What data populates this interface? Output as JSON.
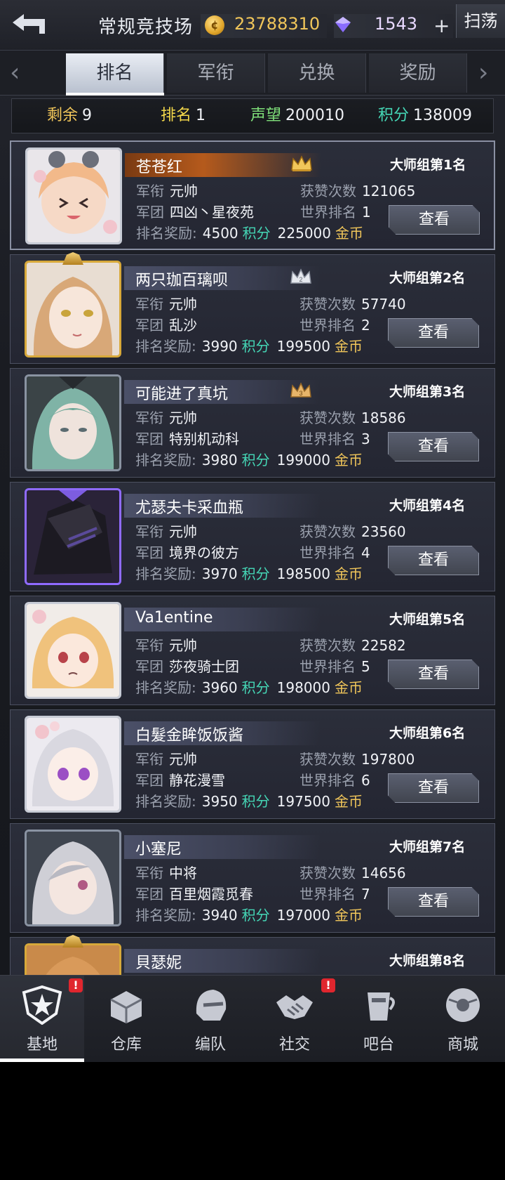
{
  "header": {
    "title": "常规竞技场",
    "coins": "23788310",
    "gems": "1543",
    "plus_label": "+",
    "sweep_label": "扫荡"
  },
  "tabs": [
    {
      "label": "排名",
      "active": true
    },
    {
      "label": "军衔",
      "active": false
    },
    {
      "label": "兑换",
      "active": false
    },
    {
      "label": "奖励",
      "active": false
    }
  ],
  "stats": {
    "remaining_label": "剩余",
    "remaining": "9",
    "rank_label": "排名",
    "rank": "1",
    "prestige_label": "声望",
    "prestige": "200010",
    "points_label": "积分",
    "points": "138009"
  },
  "labels": {
    "military_rank": "军衔",
    "legion": "军团",
    "likes": "获赞次数",
    "world_rank": "世界排名",
    "reward": "排名奖励:",
    "points_unit": "积分",
    "gold_unit": "金币",
    "view": "查看"
  },
  "players": [
    {
      "name": "苍苍红",
      "group_rank": "大师组第1名",
      "military_rank": "元帅",
      "legion": "四凶丶星夜苑",
      "likes": "121065",
      "world_rank": "1",
      "reward_points": "4500",
      "reward_gold": "225000",
      "crown": "1"
    },
    {
      "name": "两只珈百璃呗",
      "group_rank": "大师组第2名",
      "military_rank": "元帅",
      "legion": "乱沙",
      "likes": "57740",
      "world_rank": "2",
      "reward_points": "3990",
      "reward_gold": "199500",
      "crown": "2"
    },
    {
      "name": "可能进了真坑",
      "group_rank": "大师组第3名",
      "military_rank": "元帅",
      "legion": "特别机动科",
      "likes": "18586",
      "world_rank": "3",
      "reward_points": "3980",
      "reward_gold": "199000",
      "crown": "3"
    },
    {
      "name": "尤瑟夫卡采血瓶",
      "group_rank": "大师组第4名",
      "military_rank": "元帅",
      "legion": "境界の彼方",
      "likes": "23560",
      "world_rank": "4",
      "reward_points": "3970",
      "reward_gold": "198500"
    },
    {
      "name": "Va1entine",
      "group_rank": "大师组第5名",
      "military_rank": "元帅",
      "legion": "莎夜骑士团",
      "likes": "22582",
      "world_rank": "5",
      "reward_points": "3960",
      "reward_gold": "198000"
    },
    {
      "name": "白髮金眸饭饭酱",
      "group_rank": "大师组第6名",
      "military_rank": "元帅",
      "legion": "静花漫雪",
      "likes": "197800",
      "world_rank": "6",
      "reward_points": "3950",
      "reward_gold": "197500"
    },
    {
      "name": "小塞尼",
      "group_rank": "大师组第7名",
      "military_rank": "中将",
      "legion": "百里烟霞觅春",
      "likes": "14656",
      "world_rank": "7",
      "reward_points": "3940",
      "reward_gold": "197000"
    },
    {
      "name": "貝瑟妮",
      "group_rank": "大师组第8名"
    }
  ],
  "nav": [
    {
      "label": "基地",
      "icon": "base-star-icon",
      "badge": "!",
      "active": true
    },
    {
      "label": "仓库",
      "icon": "warehouse-crate-icon"
    },
    {
      "label": "编队",
      "icon": "formation-helmet-icon"
    },
    {
      "label": "社交",
      "icon": "social-handshake-icon",
      "badge": "!"
    },
    {
      "label": "吧台",
      "icon": "bar-cup-icon"
    },
    {
      "label": "商城",
      "icon": "shop-robot-icon"
    }
  ],
  "colors": {
    "gold": "#f1c65a",
    "points": "#45d7b6",
    "stat_remaining": "#f1c65a",
    "stat_rank": "#f4d84a",
    "stat_prestige": "#7fe07a",
    "stat_points": "#45d7b6",
    "badge_red": "#e0262e"
  }
}
